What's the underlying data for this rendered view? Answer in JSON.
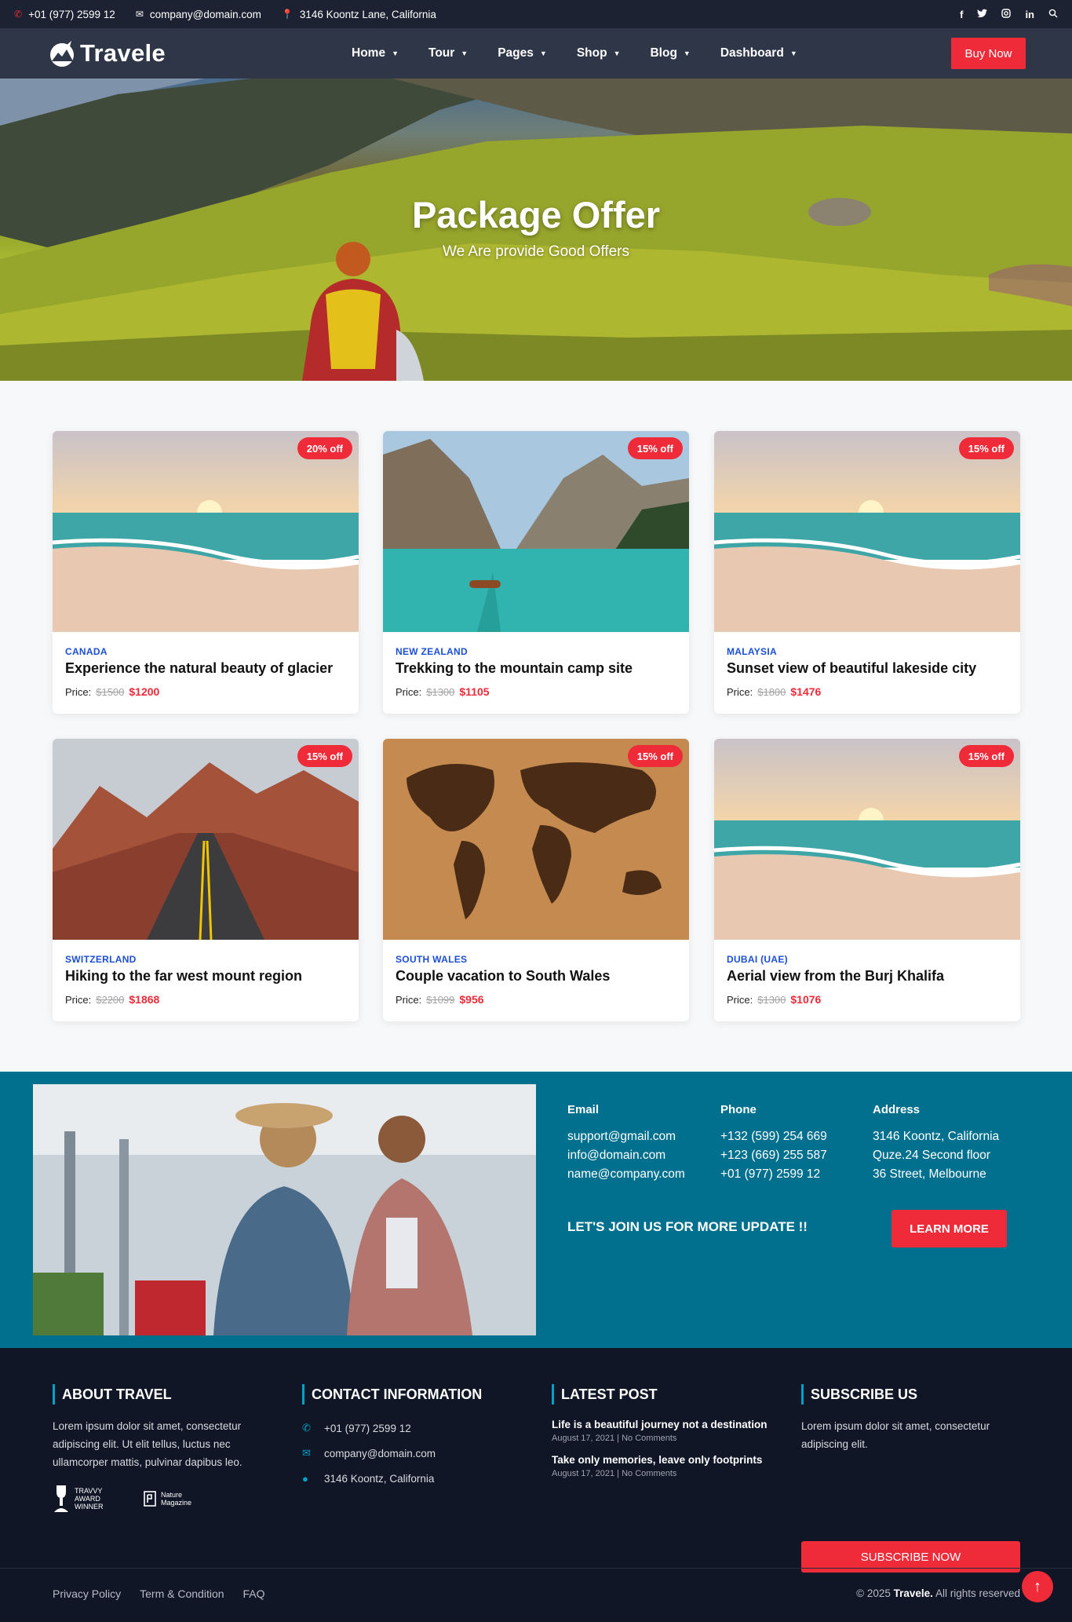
{
  "topbar": {
    "phone": "+01 (977) 2599 12",
    "email": "company@domain.com",
    "address": "3146 Koontz Lane, California",
    "social": [
      "f",
      "t",
      "ig",
      "in",
      "search"
    ]
  },
  "nav": {
    "logo": "Travele",
    "items": [
      {
        "label": "Home"
      },
      {
        "label": "Tour"
      },
      {
        "label": "Pages"
      },
      {
        "label": "Shop"
      },
      {
        "label": "Blog"
      },
      {
        "label": "Dashboard"
      }
    ],
    "cta": "Buy Now"
  },
  "hero": {
    "title": "Package Offer",
    "subtitle": "We Are provide Good Offers"
  },
  "packages": [
    {
      "badge": "20% off",
      "country": "CANADA",
      "title": "Experience the natural beauty of glacier",
      "price_label": "Price:",
      "old": "$1500",
      "new": "$1200",
      "scene": "beach"
    },
    {
      "badge": "15% off",
      "country": "NEW ZEALAND",
      "title": "Trekking to the mountain camp site",
      "price_label": "Price:",
      "old": "$1300",
      "new": "$1105",
      "scene": "lake"
    },
    {
      "badge": "15% off",
      "country": "MALAYSIA",
      "title": "Sunset view of beautiful lakeside city",
      "price_label": "Price:",
      "old": "$1800",
      "new": "$1476",
      "scene": "beach"
    },
    {
      "badge": "15% off",
      "country": "SWITZERLAND",
      "title": "Hiking to the far west mount region",
      "price_label": "Price:",
      "old": "$2200",
      "new": "$1868",
      "scene": "road"
    },
    {
      "badge": "15% off",
      "country": "SOUTH WALES",
      "title": "Couple vacation to South Wales",
      "price_label": "Price:",
      "old": "$1099",
      "new": "$956",
      "scene": "map"
    },
    {
      "badge": "15% off",
      "country": "DUBAI (UAE)",
      "title": "Aerial view from the Burj Khalifa",
      "price_label": "Price:",
      "old": "$1300",
      "new": "$1076",
      "scene": "beach"
    }
  ],
  "contact_band": {
    "email": {
      "heading": "Email",
      "lines": [
        "support@gmail.com",
        "info@domain.com",
        "name@company.com"
      ]
    },
    "phone": {
      "heading": "Phone",
      "lines": [
        "+132 (599) 254 669",
        "+123 (669) 255 587",
        "+01 (977) 2599 12"
      ]
    },
    "address": {
      "heading": "Address",
      "lines": [
        "3146 Koontz, California",
        "Quze.24 Second floor",
        "36 Street, Melbourne"
      ]
    },
    "join_text": "LET'S JOIN US FOR MORE UPDATE !!",
    "button": "LEARN MORE"
  },
  "footer": {
    "about": {
      "heading": "ABOUT TRAVEL",
      "text": "Lorem ipsum dolor sit amet, consectetur adipiscing elit. Ut elit tellus, luctus nec ullamcorper mattis, pulvinar dapibus leo.",
      "award1": "TRAVVY AWARD WINNER",
      "award2": "Nature Magazine"
    },
    "contact": {
      "heading": "CONTACT INFORMATION",
      "phone": "+01 (977) 2599 12",
      "email": "company@domain.com",
      "address": "3146 Koontz, California"
    },
    "latest": {
      "heading": "LATEST POST",
      "posts": [
        {
          "title": "Life is a beautiful journey not a destination",
          "date": "August 17, 2021",
          "comments": "No Comments"
        },
        {
          "title": "Take only memories, leave only footprints",
          "date": "August 17, 2021",
          "comments": "No Comments"
        }
      ]
    },
    "subscribe": {
      "heading": "SUBSCRIBE US",
      "text": "Lorem ipsum dolor sit amet, consectetur adipiscing elit.",
      "button": "SUBSCRIBE NOW"
    },
    "links": [
      "Privacy Policy",
      "Term & Condition",
      "FAQ"
    ],
    "copyright_pre": "© 2025",
    "copyright_brand": "Travele.",
    "copyright_post": "All rights reserved"
  }
}
